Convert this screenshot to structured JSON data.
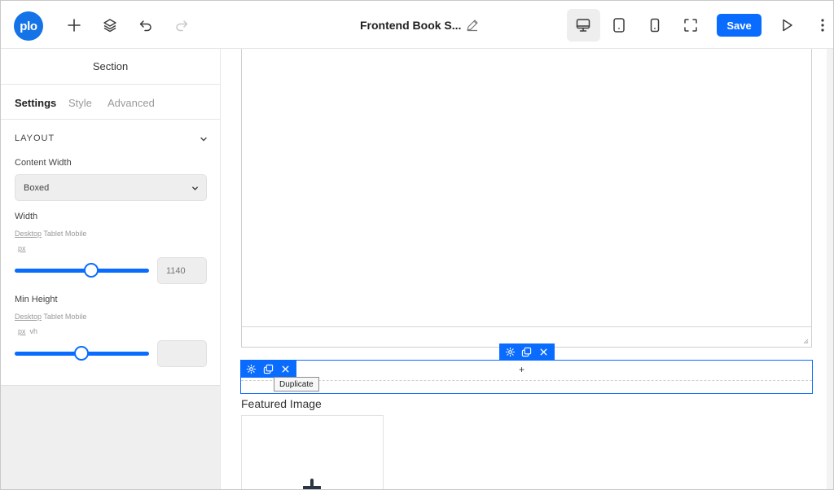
{
  "app": {
    "logo_text": "plo",
    "document_title": "Frontend Book S...",
    "save_label": "Save",
    "accent_color": "#0a6cff"
  },
  "toolbar_icons": [
    "plus-icon",
    "layers-icon",
    "undo-icon",
    "redo-icon",
    "pencil-icon",
    "desktop-icon",
    "tablet-icon",
    "mobile-icon",
    "fullscreen-icon",
    "play-icon",
    "more-vertical-icon"
  ],
  "sidebar": {
    "panel_title": "Section",
    "tabs": [
      {
        "label": "Settings",
        "active": true
      },
      {
        "label": "Style",
        "active": false
      },
      {
        "label": "Advanced",
        "active": false
      }
    ],
    "section_title": "LAYOUT",
    "content_width": {
      "label": "Content Width",
      "value": "Boxed"
    },
    "width": {
      "label": "Width",
      "devices": [
        "Desktop",
        "Tablet",
        "Mobile"
      ],
      "units": [
        "px"
      ],
      "value": "1140",
      "slider_fraction": 0.57
    },
    "min_height": {
      "label": "Min Height",
      "devices": [
        "Desktop",
        "Tablet",
        "Mobile"
      ],
      "units": [
        "px",
        "vh"
      ],
      "value": "",
      "slider_fraction": 0.5
    }
  },
  "canvas": {
    "add_symbol": "+",
    "tooltip": "Duplicate",
    "featured_image_label": "Featured Image"
  }
}
